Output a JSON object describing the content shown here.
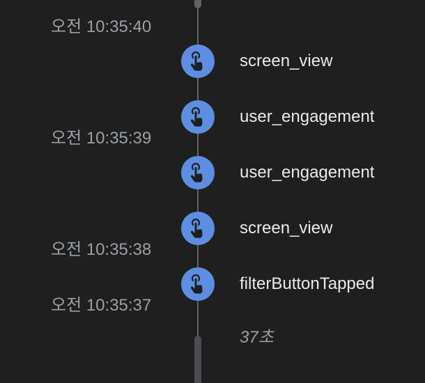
{
  "timestamps": [
    "오전 10:35:40",
    "오전 10:35:39",
    "오전 10:35:38",
    "오전 10:35:37"
  ],
  "events": [
    {
      "label": "screen_view",
      "icon": "touch-icon"
    },
    {
      "label": "user_engagement",
      "icon": "touch-icon"
    },
    {
      "label": "user_engagement",
      "icon": "touch-icon"
    },
    {
      "label": "screen_view",
      "icon": "touch-icon"
    },
    {
      "label": "filterButtonTapped",
      "icon": "touch-icon"
    }
  ],
  "duration_label": "37초",
  "colors": {
    "background": "#1f1f1f",
    "icon_fill": "#5e8ee3",
    "timeline": "#5f6368",
    "timestamp_text": "#9aa0a6",
    "event_text": "#e8eaed"
  }
}
